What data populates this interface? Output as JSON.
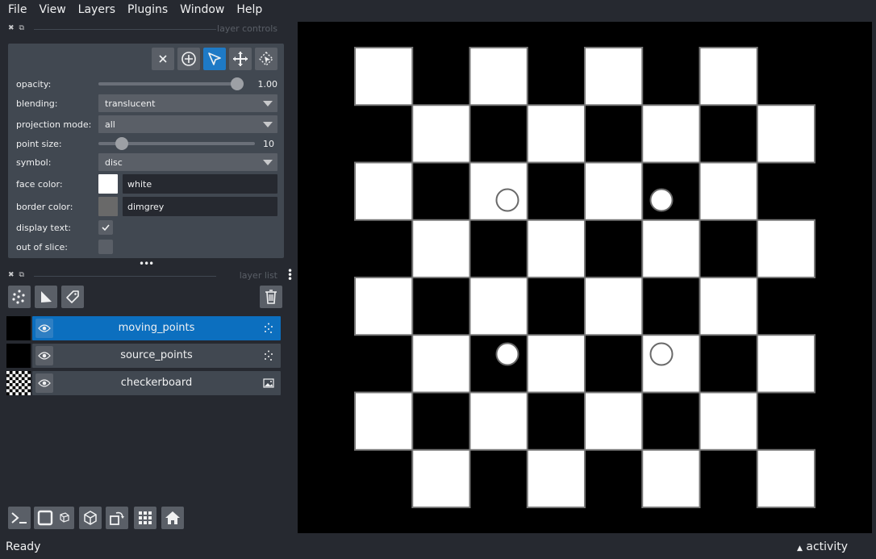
{
  "menu": [
    "File",
    "View",
    "Layers",
    "Plugins",
    "Window",
    "Help"
  ],
  "layer_controls": {
    "title": "layer controls",
    "mode_buttons": [
      "delete-icon",
      "add-point-icon",
      "select-icon",
      "pan-zoom-icon",
      "transform-icon"
    ],
    "active_mode": "select-icon",
    "opacity_label": "opacity:",
    "opacity_value": "1.00",
    "opacity_fraction": 1.0,
    "blending_label": "blending:",
    "blending_value": "translucent",
    "projection_label": "projection mode:",
    "projection_value": "all",
    "point_size_label": "point size:",
    "point_size_value": "10",
    "point_size_fraction": 0.12,
    "symbol_label": "symbol:",
    "symbol_value": "disc",
    "face_color_label": "face color:",
    "face_color_value": "white",
    "face_color_hex": "#ffffff",
    "border_color_label": "border color:",
    "border_color_value": "dimgrey",
    "border_color_hex": "#696969",
    "display_text_label": "display text:",
    "display_text_checked": true,
    "out_of_slice_label": "out of slice:",
    "out_of_slice_checked": false
  },
  "layer_list": {
    "title": "layer list",
    "layers": [
      {
        "name": "moving_points",
        "type": "points",
        "selected": true
      },
      {
        "name": "source_points",
        "type": "points",
        "selected": false
      },
      {
        "name": "checkerboard",
        "type": "image",
        "selected": false
      }
    ]
  },
  "status": {
    "ready": "Ready",
    "activity": "activity"
  },
  "colors": {
    "accent": "#0c6fbf",
    "panel": "#414851",
    "background": "#262930"
  }
}
